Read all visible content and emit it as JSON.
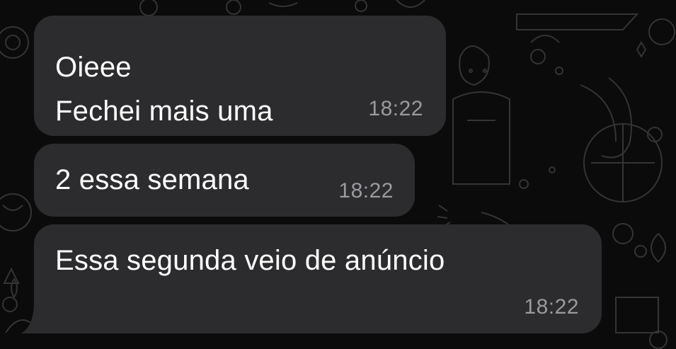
{
  "messages": [
    {
      "lines": [
        "Oieee",
        "Fechei mais uma"
      ],
      "time": "18:22"
    },
    {
      "lines": [
        "2 essa semana"
      ],
      "time": "18:22"
    },
    {
      "lines": [
        "Essa segunda veio de anúncio"
      ],
      "time": "18:22"
    }
  ],
  "colors": {
    "background": "#0b0b0b",
    "bubble": "#2c2c2e",
    "text": "#ffffff",
    "timestamp": "#9a9a9f",
    "doodle": "#3a3a3a"
  }
}
